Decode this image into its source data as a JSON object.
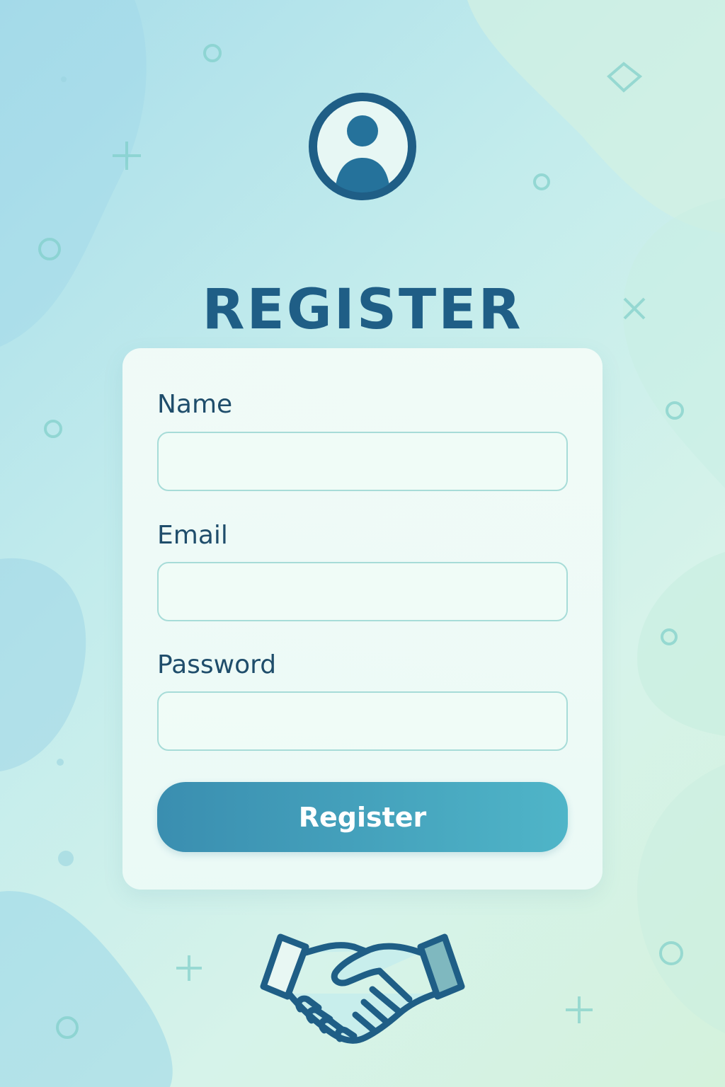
{
  "page": {
    "title": "REGISTER"
  },
  "form": {
    "name_label": "Name",
    "name_value": "",
    "email_label": "Email",
    "email_value": "",
    "password_label": "Password",
    "password_value": "",
    "submit_label": "Register"
  },
  "icons": {
    "avatar": "user-avatar-icon",
    "handshake": "handshake-icon"
  },
  "colors": {
    "primary": "#1f5e86",
    "button_start": "#3a8eb0",
    "button_end": "#4fb5c8",
    "input_border": "#a7dcd8"
  }
}
